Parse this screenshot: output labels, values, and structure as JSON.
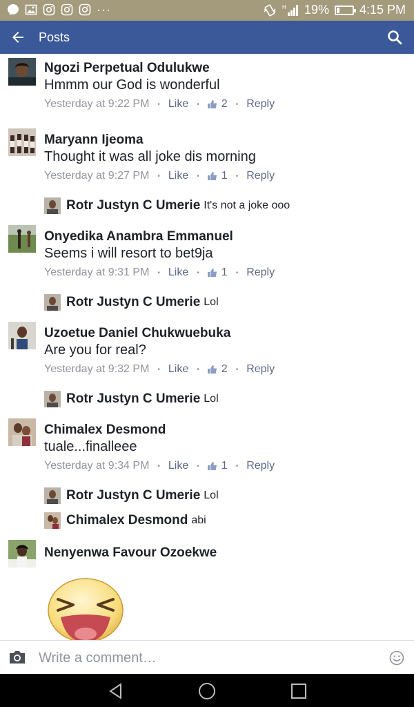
{
  "status_bar": {
    "battery": "19%",
    "battery_level": 0.19,
    "time": "4:15 PM",
    "more": "···",
    "icons": [
      "messenger-icon",
      "gallery-icon",
      "instagram-icon",
      "instagram-icon",
      "instagram-icon",
      "vibrate-icon",
      "signal-icon",
      "battery-icon"
    ]
  },
  "header": {
    "title": "Posts",
    "back_icon": "arrow-left-icon",
    "search_icon": "search-icon",
    "color": "#3b5998"
  },
  "meta_labels": {
    "like": "Like",
    "reply": "Reply"
  },
  "comments": [
    {
      "name": "Ngozi Perpetual Odulukwe",
      "text": "Hmmm our God is wonderful",
      "time": "Yesterday at 9:22 PM",
      "likes": "2"
    },
    {
      "name": "Maryann Ijeoma",
      "text": "Thought it was all joke dis morning",
      "time": "Yesterday at 9:27 PM",
      "likes": "1"
    },
    {
      "name": "Onyedika Anambra Emmanuel",
      "text": "Seems i will resort to bet9ja",
      "time": "Yesterday at 9:31 PM",
      "likes": "1"
    },
    {
      "name": "Uzoetue Daniel Chukwuebuka",
      "text": "Are you for real?",
      "time": "Yesterday at 9:32 PM",
      "likes": "2"
    },
    {
      "name": "Chimalex Desmond",
      "text": "tuale...finalleee",
      "time": "Yesterday at 9:34 PM",
      "likes": "1"
    },
    {
      "name": "Nenyenwa Favour Ozoekwe",
      "sticker": "laughing-face-sticker"
    }
  ],
  "replies": [
    {
      "name": "Rotr Justyn C Umerie",
      "text": "It's not a joke ooo"
    },
    {
      "name": "Rotr Justyn C Umerie",
      "text": "Lol"
    },
    {
      "name": "Rotr Justyn C Umerie",
      "text": "Lol"
    },
    {
      "name": "Rotr Justyn C Umerie",
      "text": "Lol"
    },
    {
      "name": "Chimalex Desmond",
      "text": "abi"
    }
  ],
  "composer": {
    "placeholder": "Write a comment…",
    "camera_icon": "camera-icon",
    "emoji_icon": "smiley-icon"
  },
  "nav": [
    "back-triangle-icon",
    "home-circle-icon",
    "recents-square-icon"
  ]
}
